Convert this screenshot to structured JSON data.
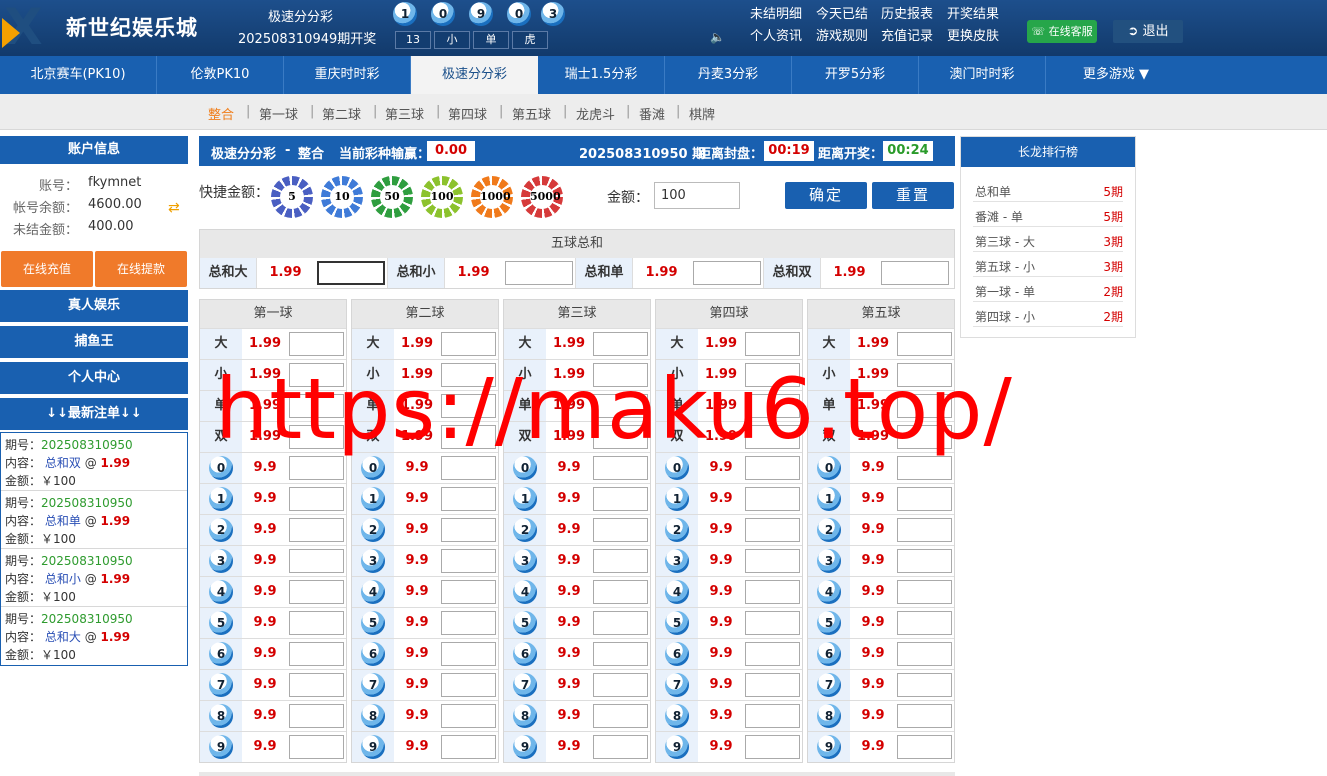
{
  "header": {
    "brand": "新世纪娱乐城",
    "draw_name": "极速分分彩",
    "draw_period": "202508310949期开奖",
    "result_balls": [
      "1",
      "0",
      "9",
      "0",
      "3"
    ],
    "result_tags": [
      "13",
      "小",
      "单",
      "虎"
    ],
    "links": [
      "未结明细",
      "今天已结",
      "历史报表",
      "开奖结果",
      "个人资讯",
      "游戏规则",
      "充值记录",
      "更换皮肤"
    ],
    "service": "在线客服",
    "logout": "退出"
  },
  "nav": [
    "北京赛车(PK10)",
    "伦敦PK10",
    "重庆时时彩",
    "极速分分彩",
    "瑞士1.5分彩",
    "丹麦3分彩",
    "开罗5分彩",
    "澳门时时彩",
    "更多游戏 ▼"
  ],
  "subnav": [
    "整合",
    "第一球",
    "第二球",
    "第三球",
    "第四球",
    "第五球",
    "龙虎斗",
    "番滩",
    "棋牌"
  ],
  "side": {
    "account_title": "账户信息",
    "account_label": "账号：",
    "account_value": "fkymnet",
    "balance_label": "帐号余额：",
    "balance_value": "4600.00",
    "unsettled_label": "未结金额：",
    "unsettled_value": "400.00",
    "recharge": "在线充值",
    "withdraw": "在线提款",
    "menus": [
      "真人娱乐",
      "捕鱼王",
      "个人中心",
      "↓↓最新注单↓↓"
    ],
    "bets": [
      {
        "period_label": "期号：",
        "period": "202508310950",
        "content_label": "内容：",
        "content": "总和双",
        "at": "@",
        "odds": "1.99",
        "amount_label": "金额：",
        "amount": "￥100"
      },
      {
        "period_label": "期号：",
        "period": "202508310950",
        "content_label": "内容：",
        "content": "总和单",
        "at": "@",
        "odds": "1.99",
        "amount_label": "金额：",
        "amount": "￥100"
      },
      {
        "period_label": "期号：",
        "period": "202508310950",
        "content_label": "内容：",
        "content": "总和小",
        "at": "@",
        "odds": "1.99",
        "amount_label": "金额：",
        "amount": "￥100"
      },
      {
        "period_label": "期号：",
        "period": "202508310950",
        "content_label": "内容：",
        "content": "总和大",
        "at": "@",
        "odds": "1.99",
        "amount_label": "金额：",
        "amount": "￥100"
      }
    ]
  },
  "main": {
    "game": "极速分分彩",
    "dash": "-",
    "mode": "整合",
    "profit_label": "当前彩种输赢：",
    "profit": "0.00",
    "period": "202508310950 期",
    "close_label": "距离封盘：",
    "close_time": "00:19",
    "draw_label": "距离开奖：",
    "draw_time": "00:24",
    "quick_label": "快捷金额：",
    "chips": [
      "5",
      "10",
      "50",
      "100",
      "1000",
      "5000"
    ],
    "chip_colors": [
      "#4a5fc2",
      "#3f7bd8",
      "#2f9e3f",
      "#8cc22d",
      "#f07a1b",
      "#d63a3a"
    ],
    "amount_label": "金额：",
    "amount_value": "100",
    "confirm": "确定",
    "reset": "重置",
    "sum_title": "五球总和",
    "sum_cells": [
      {
        "label": "总和大",
        "odds": "1.99"
      },
      {
        "label": "总和小",
        "odds": "1.99"
      },
      {
        "label": "总和单",
        "odds": "1.99"
      },
      {
        "label": "总和双",
        "odds": "1.99"
      }
    ],
    "columns": [
      "第一球",
      "第二球",
      "第三球",
      "第四球",
      "第五球"
    ],
    "text_rows": [
      {
        "label": "大",
        "odds": "1.99"
      },
      {
        "label": "小",
        "odds": "1.99"
      },
      {
        "label": "单",
        "odds": "1.99"
      },
      {
        "label": "双",
        "odds": "1.99"
      }
    ],
    "number_rows": [
      "0",
      "1",
      "2",
      "3",
      "4",
      "5",
      "6",
      "7",
      "8",
      "9"
    ],
    "number_odds": "9.9"
  },
  "ranking": {
    "title": "长龙排行榜",
    "rows": [
      {
        "name": "总和单",
        "value": "5期"
      },
      {
        "name": "番滩 - 单",
        "value": "5期"
      },
      {
        "name": "第三球 - 大",
        "value": "3期"
      },
      {
        "name": "第五球 - 小",
        "value": "3期"
      },
      {
        "name": "第一球 - 单",
        "value": "2期"
      },
      {
        "name": "第四球 - 小",
        "value": "2期"
      }
    ]
  },
  "watermark": "https://maku6.top/"
}
